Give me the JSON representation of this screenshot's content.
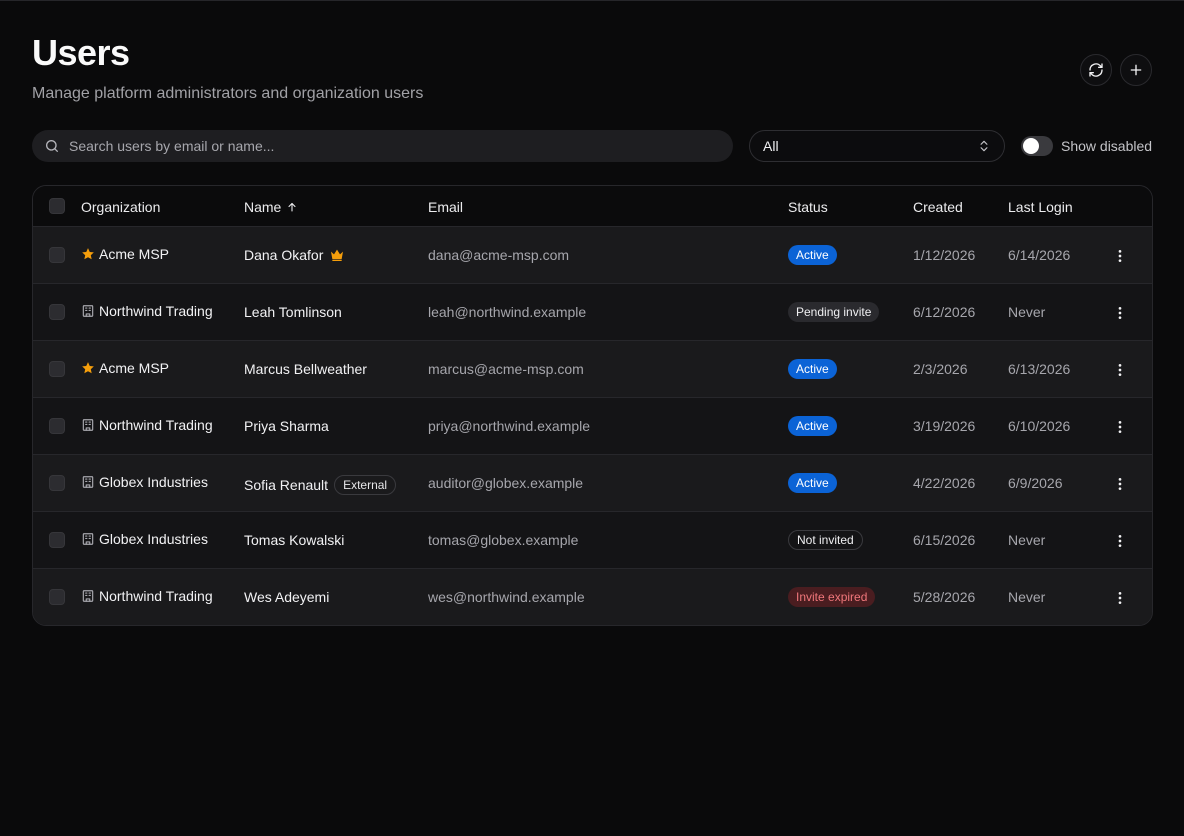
{
  "header": {
    "title": "Users",
    "subtitle": "Manage platform administrators and organization users"
  },
  "toolbar": {
    "search_placeholder": "Search users by email or name...",
    "filter_value": "All",
    "toggle_label": "Show disabled"
  },
  "table": {
    "columns": {
      "organization": "Organization",
      "name": "Name",
      "email": "Email",
      "status": "Status",
      "created": "Created",
      "last_login": "Last Login"
    },
    "rows": [
      {
        "org": "Acme MSP",
        "org_icon": "star-icon",
        "name": "Dana Okafor",
        "name_icon": "crown-icon",
        "email": "dana@acme-msp.com",
        "status": "Active",
        "status_kind": "active",
        "created": "1/12/2026",
        "last_login": "6/14/2026"
      },
      {
        "org": "Northwind Trading",
        "org_icon": "building-icon",
        "name": "Leah Tomlinson",
        "email": "leah@northwind.example",
        "status": "Pending invite",
        "status_kind": "pending",
        "created": "6/12/2026",
        "last_login": "Never"
      },
      {
        "org": "Acme MSP",
        "org_icon": "star-icon",
        "name": "Marcus Bellweather",
        "email": "marcus@acme-msp.com",
        "status": "Active",
        "status_kind": "active",
        "created": "2/3/2026",
        "last_login": "6/13/2026"
      },
      {
        "org": "Northwind Trading",
        "org_icon": "building-icon",
        "name": "Priya Sharma",
        "email": "priya@northwind.example",
        "status": "Active",
        "status_kind": "active",
        "created": "3/19/2026",
        "last_login": "6/10/2026"
      },
      {
        "org": "Globex Industries",
        "org_icon": "building-icon",
        "name": "Sofia Renault",
        "name_badge": "External",
        "email": "auditor@globex.example",
        "status": "Active",
        "status_kind": "active",
        "created": "4/22/2026",
        "last_login": "6/9/2026"
      },
      {
        "org": "Globex Industries",
        "org_icon": "building-icon",
        "name": "Tomas Kowalski",
        "email": "tomas@globex.example",
        "status": "Not invited",
        "status_kind": "notinv",
        "created": "6/15/2026",
        "last_login": "Never"
      },
      {
        "org": "Northwind Trading",
        "org_icon": "building-icon",
        "name": "Wes Adeyemi",
        "email": "wes@northwind.example",
        "status": "Invite expired",
        "status_kind": "expired",
        "created": "5/28/2026",
        "last_login": "Never"
      }
    ]
  },
  "colors": {
    "accent_active": "#0b63d6",
    "star": "#f59e0b",
    "expired_text": "#f0777b"
  }
}
